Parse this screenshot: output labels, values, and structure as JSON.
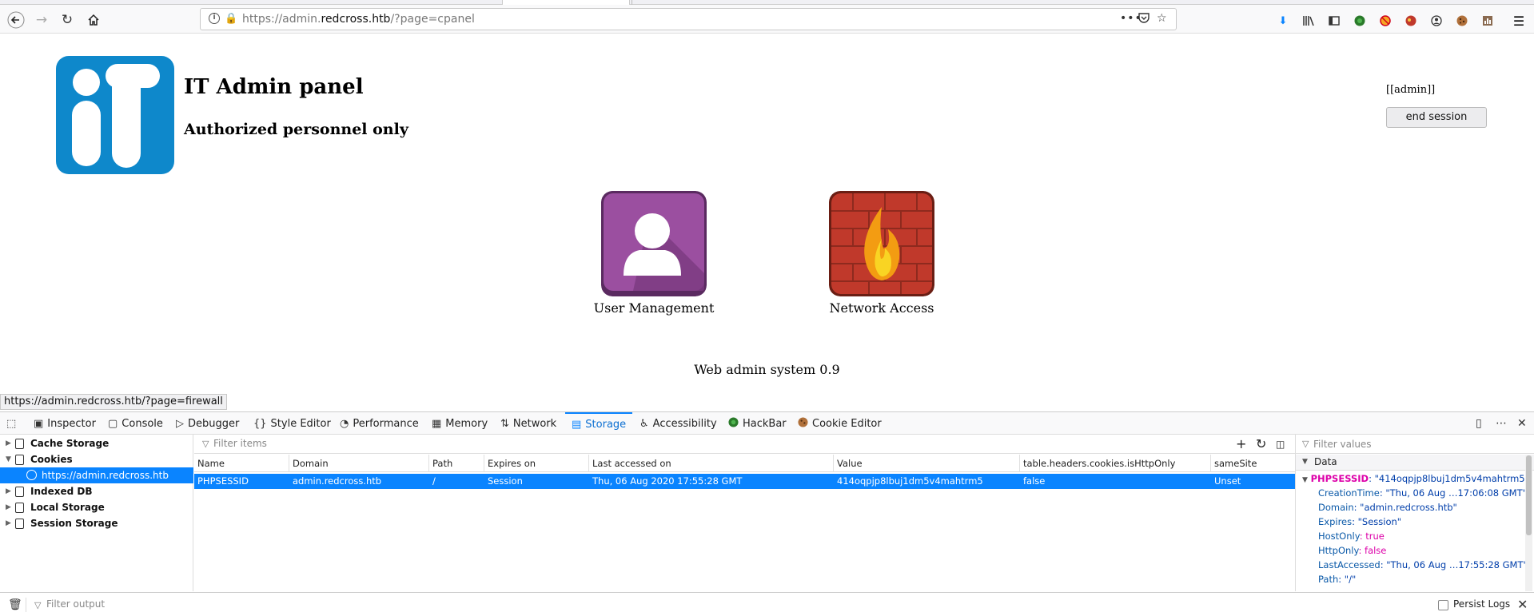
{
  "browser": {
    "url_prefix": "https://admin.",
    "url_domain": "redcross.htb",
    "url_path": "/?page=cpanel",
    "page_actions": "•••",
    "status_link": "https://admin.redcross.htb/?page=firewall"
  },
  "page": {
    "title": "IT Admin panel",
    "subtitle": "Authorized personnel only",
    "user_label": "[[admin]]",
    "end_session": "end session",
    "apps": [
      {
        "label": "User Management"
      },
      {
        "label": "Network Access"
      }
    ],
    "footer": "Web admin system 0.9"
  },
  "devtools": {
    "tabs": [
      {
        "label": "Inspector"
      },
      {
        "label": "Console"
      },
      {
        "label": "Debugger"
      },
      {
        "label": "Style Editor"
      },
      {
        "label": "Performance"
      },
      {
        "label": "Memory"
      },
      {
        "label": "Network"
      },
      {
        "label": "Storage"
      },
      {
        "label": "Accessibility"
      },
      {
        "label": "HackBar"
      },
      {
        "label": "Cookie Editor"
      }
    ],
    "sidebar": [
      {
        "label": "Cache Storage"
      },
      {
        "label": "Cookies"
      },
      {
        "label": "https://admin.redcross.htb"
      },
      {
        "label": "Indexed DB"
      },
      {
        "label": "Local Storage"
      },
      {
        "label": "Session Storage"
      }
    ],
    "filter_items": "Filter items",
    "filter_values": "Filter values",
    "columns": [
      "Name",
      "Domain",
      "Path",
      "Expires on",
      "Last accessed on",
      "Value",
      "table.headers.cookies.isHttpOnly",
      "sameSite"
    ],
    "row": [
      "PHPSESSID",
      "admin.redcross.htb",
      "/",
      "Session",
      "Thu, 06 Aug 2020 17:55:28 GMT",
      "414oqpjp8lbuj1dm5v4mahtrm5",
      "false",
      "Unset"
    ],
    "data_header": "Data",
    "details": {
      "name_key": "PHPSESSID",
      "name_val": ": \"414oqpjp8lbuj1dm5v4mahtrm5\"",
      "creation_key": "CreationTime",
      "creation_val": ": \"Thu, 06 Aug …17:06:08 GMT\"",
      "domain_key": "Domain",
      "domain_val": ": \"admin.redcross.htb\"",
      "expires_key": "Expires",
      "expires_val": ": \"Session\"",
      "hostonly_key": "HostOnly",
      "hostonly_val": ": true",
      "httponly_key": "HttpOnly",
      "httponly_val": ": false",
      "lastacc_key": "LastAccessed",
      "lastacc_val": ": \"Thu, 06 Aug …17:55:28 GMT\"",
      "path_key": "Path",
      "path_val": ": \"/\""
    },
    "console_filter": "Filter output",
    "persist_logs": "Persist Logs"
  }
}
